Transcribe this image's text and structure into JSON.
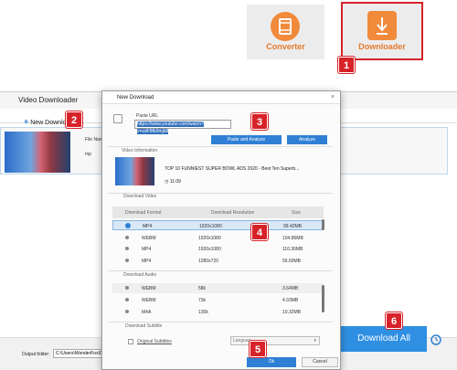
{
  "tools": {
    "converter_label": "Converter",
    "downloader_label": "Downloader"
  },
  "badges": [
    "1",
    "2",
    "3",
    "4",
    "5",
    "6"
  ],
  "downloader_window": {
    "title": "Video Downloader",
    "new_download_label": "New Download",
    "file_name_label": "File Nam",
    "file_type_label": "mp",
    "output_folder_label": "Output folder:",
    "output_folder_value": "C:\\Users\\WonderFox\\Docu",
    "download_all_label": "Download All"
  },
  "dialog": {
    "title": "New Download",
    "paste_url_label": "Paste URL",
    "url_value": "https://www.youtube.com/watch?v=zdF8fb9mjb8",
    "paste_analyze_label": "Paste and Analyze",
    "analyze_label": "Analyze",
    "video_info_label": "Video Information",
    "video_title": "TOP 10 FUNNIEST SUPER BOWL ADS 2020 - Best Ten Superb...",
    "duration": "11:09",
    "download_video_label": "Download Video",
    "video_headers": [
      "Download Format",
      "Download Resolution",
      "Size"
    ],
    "video_rows": [
      {
        "format": "MP4",
        "resolution": "1920x1080",
        "size": "99.42MB",
        "selected": true
      },
      {
        "format": "WEBM",
        "resolution": "1920x1080",
        "size": "104.86MB",
        "selected": false
      },
      {
        "format": "MP4",
        "resolution": "1920x1080",
        "size": "110.36MB",
        "selected": false
      },
      {
        "format": "MP4",
        "resolution": "1280x720",
        "size": "56.69MB",
        "selected": false
      }
    ],
    "download_audio_label": "Download Audio",
    "audio_rows": [
      {
        "format": "WEBM",
        "bitrate": "58k",
        "size": "3.64MB"
      },
      {
        "format": "WEBM",
        "bitrate": "73k",
        "size": "4.93MB"
      },
      {
        "format": "M4A",
        "bitrate": "130k",
        "size": "10.32MB"
      }
    ],
    "download_subtitle_label": "Download Subtitle",
    "original_subtitles_label": "Original Subtitles",
    "language_label": "Languag",
    "ok_label": "Ok",
    "cancel_label": "Cancel"
  },
  "colors": {
    "accent_orange": "#f18a3b",
    "badge_red": "#d62228",
    "primary_blue": "#2f80d5"
  }
}
